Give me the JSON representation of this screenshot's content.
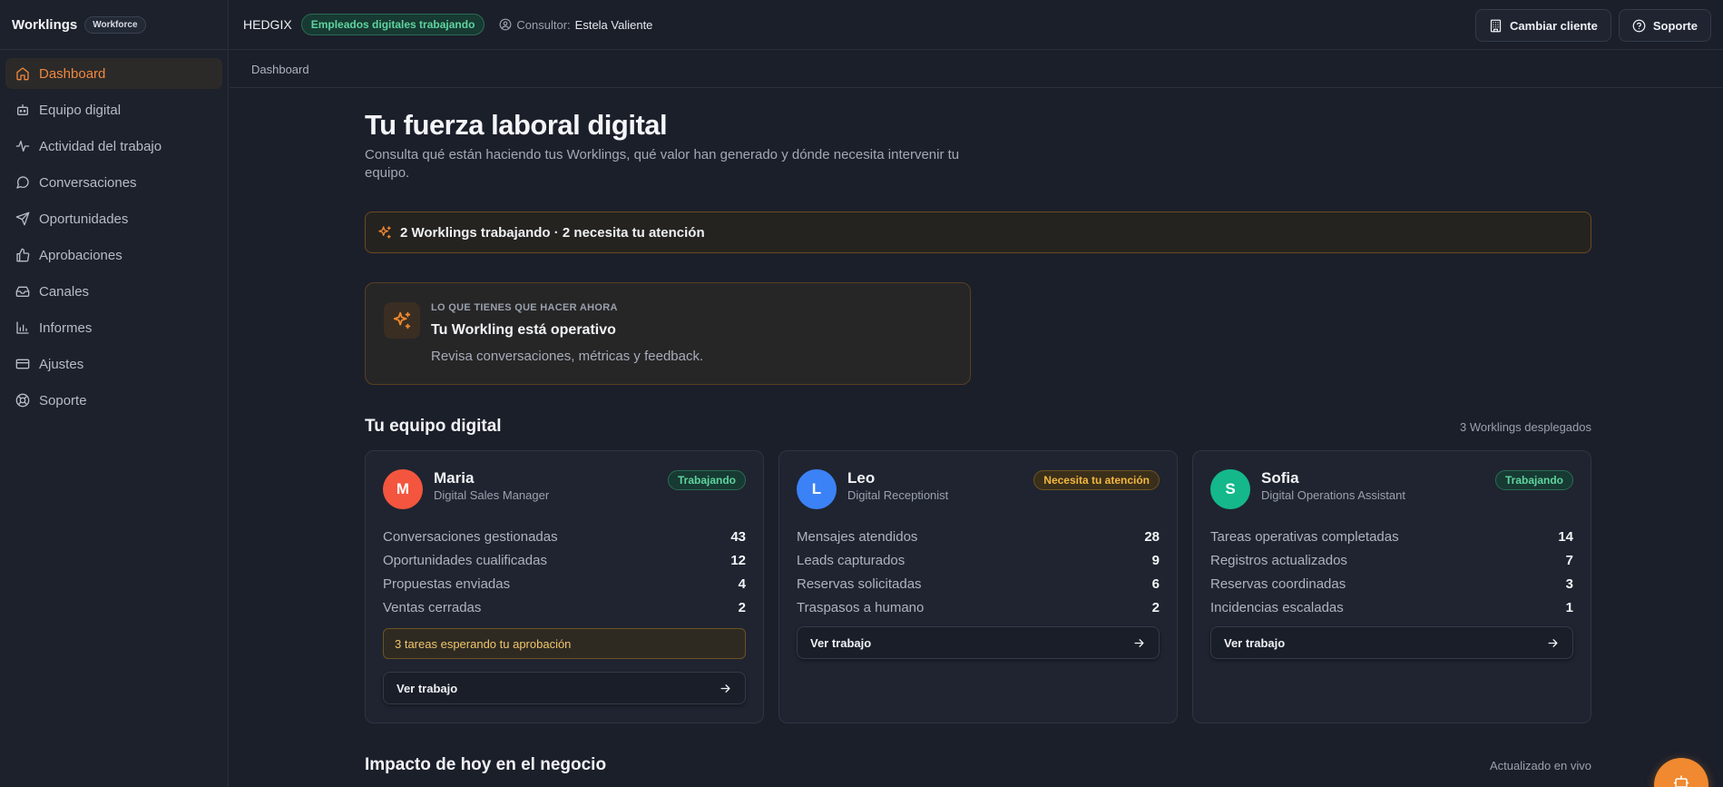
{
  "brand": {
    "name": "Worklings",
    "badge": "Workforce"
  },
  "sidebar": {
    "items": [
      {
        "label": "Dashboard",
        "icon": "home-icon",
        "active": true
      },
      {
        "label": "Equipo digital",
        "icon": "bot-icon"
      },
      {
        "label": "Actividad del trabajo",
        "icon": "activity-icon"
      },
      {
        "label": "Conversaciones",
        "icon": "chat-icon"
      },
      {
        "label": "Oportunidades",
        "icon": "send-icon"
      },
      {
        "label": "Aprobaciones",
        "icon": "thumbs-up-icon"
      },
      {
        "label": "Canales",
        "icon": "inbox-icon"
      },
      {
        "label": "Informes",
        "icon": "bar-chart-icon"
      },
      {
        "label": "Ajustes",
        "icon": "credit-card-icon"
      },
      {
        "label": "Soporte",
        "icon": "life-buoy-icon"
      }
    ]
  },
  "topbar": {
    "client": "HEDGIX",
    "status": "Empleados digitales trabajando",
    "consultor_label": "Consultor:",
    "consultor_name": "Estela Valiente",
    "change_client": "Cambiar cliente",
    "support": "Soporte"
  },
  "breadcrumb": "Dashboard",
  "page": {
    "title": "Tu fuerza laboral digital",
    "subtitle": "Consulta qué están haciendo tus Worklings, qué valor han generado y dónde necesita intervenir tu equipo."
  },
  "alert": {
    "text": "2 Worklings trabajando · 2 necesita tu atención"
  },
  "todo": {
    "eyebrow": "LO QUE TIENES QUE HACER AHORA",
    "title": "Tu Workling está operativo",
    "description": "Revisa conversaciones, métricas y feedback."
  },
  "team": {
    "title": "Tu equipo digital",
    "meta": "3 Worklings desplegados",
    "button_label": "Ver trabajo",
    "workers": [
      {
        "initial": "M",
        "name": "Maria",
        "role": "Digital Sales Manager",
        "status": "Trabajando",
        "status_type": "working",
        "avatar_color": "#f4553e",
        "metrics": [
          {
            "label": "Conversaciones gestionadas",
            "value": "43"
          },
          {
            "label": "Oportunidades cualificadas",
            "value": "12"
          },
          {
            "label": "Propuestas enviadas",
            "value": "4"
          },
          {
            "label": "Ventas cerradas",
            "value": "2"
          }
        ],
        "pending": "3 tareas esperando tu aprobación"
      },
      {
        "initial": "L",
        "name": "Leo",
        "role": "Digital Receptionist",
        "status": "Necesita tu atención",
        "status_type": "attention",
        "avatar_color": "#3b82f6",
        "metrics": [
          {
            "label": "Mensajes atendidos",
            "value": "28"
          },
          {
            "label": "Leads capturados",
            "value": "9"
          },
          {
            "label": "Reservas solicitadas",
            "value": "6"
          },
          {
            "label": "Traspasos a humano",
            "value": "2"
          }
        ]
      },
      {
        "initial": "S",
        "name": "Sofia",
        "role": "Digital Operations Assistant",
        "status": "Trabajando",
        "status_type": "working",
        "avatar_color": "#14b88a",
        "metrics": [
          {
            "label": "Tareas operativas completadas",
            "value": "14"
          },
          {
            "label": "Registros actualizados",
            "value": "7"
          },
          {
            "label": "Reservas coordinadas",
            "value": "3"
          },
          {
            "label": "Incidencias escaladas",
            "value": "1"
          }
        ]
      }
    ]
  },
  "impact": {
    "title": "Impacto de hoy en el negocio",
    "meta": "Actualizado en vivo"
  },
  "colors": {
    "accent": "#f0892f",
    "working": "#5fd3a0",
    "attention": "#f4b740"
  }
}
